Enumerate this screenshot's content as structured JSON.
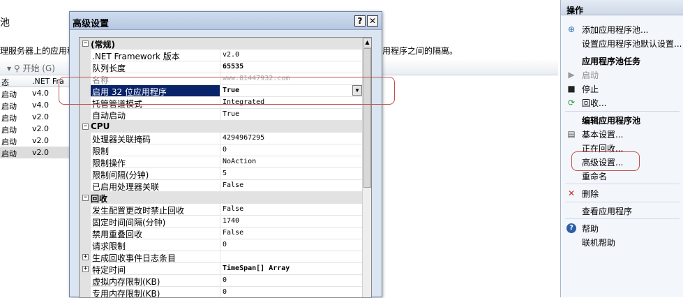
{
  "background": {
    "title_fragment": "池",
    "description_left": "理服务器上的应用程",
    "description_right": "用程序之间的隔离。",
    "toolbar_start": "开始 (G)",
    "columns": [
      "态",
      ".NET Fra"
    ],
    "rows": [
      {
        "status": "启动",
        "version": "v4.0"
      },
      {
        "status": "启动",
        "version": "v4.0"
      },
      {
        "status": "启动",
        "version": "v2.0"
      },
      {
        "status": "启动",
        "version": "v2.0"
      },
      {
        "status": "启动",
        "version": "v2.0"
      },
      {
        "status": "启动",
        "version": "v2.0"
      }
    ]
  },
  "dialog": {
    "title": "高级设置",
    "help_btn": "?",
    "close_btn": "✕",
    "sections": {
      "general": "(常规)",
      "cpu": "CPU",
      "recycle": "回收"
    },
    "props": {
      "netfx": {
        "name": ".NET Framework 版本",
        "value": "v2.0"
      },
      "queue": {
        "name": "队列长度",
        "value": "65535"
      },
      "name": {
        "name": "名称",
        "value": "www.81447932.com"
      },
      "enable32": {
        "name": "启用 32 位应用程序",
        "value": "True"
      },
      "pipeline": {
        "name": "托管管道模式",
        "value": "Integrated"
      },
      "autostart": {
        "name": "自动启动",
        "value": "True"
      },
      "affinity": {
        "name": "处理器关联掩码",
        "value": "4294967295"
      },
      "limit": {
        "name": "限制",
        "value": "0"
      },
      "limit_action": {
        "name": "限制操作",
        "value": "NoAction"
      },
      "limit_interval": {
        "name": "限制间隔(分钟)",
        "value": "5"
      },
      "proc_affinity": {
        "name": "已启用处理器关联",
        "value": "False"
      },
      "disallow_rotation": {
        "name": "发生配置更改时禁止回收",
        "value": "False"
      },
      "fixed_interval": {
        "name": "固定时间间隔(分钟)",
        "value": "1740"
      },
      "disable_overlap": {
        "name": "禁用重叠回收",
        "value": "False"
      },
      "request_limit": {
        "name": "请求限制",
        "value": "0"
      },
      "log_events": {
        "name": "生成回收事件日志条目",
        "value": ""
      },
      "specific_time": {
        "name": "特定时间",
        "value": "TimeSpan[] Array"
      },
      "virtual_mem": {
        "name": "虚拟内存限制(KB)",
        "value": "0"
      },
      "private_mem": {
        "name": "专用内存限制(KB)",
        "value": "0"
      }
    }
  },
  "actions": {
    "header": "操作",
    "add_pool": "添加应用程序池...",
    "set_defaults": "设置应用程序池默认设置...",
    "tasks_header": "应用程序池任务",
    "start": "启动",
    "stop": "停止",
    "recycle": "回收...",
    "edit_header": "编辑应用程序池",
    "basic_settings": "基本设置...",
    "recycling": "正在回收...",
    "advanced_settings": "高级设置...",
    "rename": "重命名",
    "delete": "删除",
    "view_apps": "查看应用程序",
    "help": "帮助",
    "online_help": "联机帮助"
  },
  "colors": {
    "selection": "#0a246a",
    "annotation": "#c0504d",
    "dialog_bg": "#dbe5f1"
  }
}
